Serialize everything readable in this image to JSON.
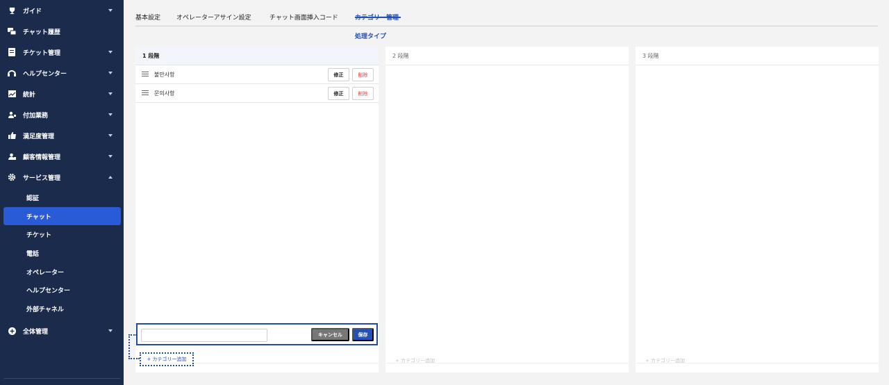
{
  "sidebar": {
    "items": [
      {
        "label": "ガイド",
        "icon": "trophy-icon"
      },
      {
        "label": "チャット履歴",
        "icon": "chat-bubbles-icon"
      },
      {
        "label": "チケット管理",
        "icon": "ticket-icon"
      },
      {
        "label": "ヘルプセンター",
        "icon": "headset-icon"
      },
      {
        "label": "統計",
        "icon": "chart-icon"
      },
      {
        "label": "付加業務",
        "icon": "users-icon"
      },
      {
        "label": "満足度管理",
        "icon": "thumbs-up-icon"
      },
      {
        "label": "顧客情報管理",
        "icon": "user-card-icon"
      },
      {
        "label": "サービス管理",
        "icon": "gear-icon"
      },
      {
        "label": "全体管理",
        "icon": "plus-circle-icon"
      }
    ],
    "sub_items": [
      "認証",
      "チャット",
      "チケット",
      "電話",
      "オペレーター",
      "ヘルプセンター",
      "外部チャネル"
    ],
    "active_sub_item": "チャット"
  },
  "tabs": [
    "基本設定",
    "オペレーターアサイン設定",
    "チャット画面挿入コード",
    "カテゴリー管理"
  ],
  "active_tab": "カテゴリー管理",
  "subtab": "処理タイプ",
  "panels": [
    {
      "title": "1 段階",
      "rows": [
        {
          "label": "불만사항",
          "edit": "修正",
          "delete": "削除"
        },
        {
          "label": "문의사항",
          "edit": "修正",
          "delete": "削除"
        }
      ],
      "input_value": "",
      "cancel_label": "キャンセル",
      "save_label": "保存",
      "add_label": "+ カテゴリー追加"
    },
    {
      "title": "2 段階",
      "add_label": "+ カテゴリー追加"
    },
    {
      "title": "3 段階",
      "add_label": "+ カテゴリー追加"
    }
  ]
}
